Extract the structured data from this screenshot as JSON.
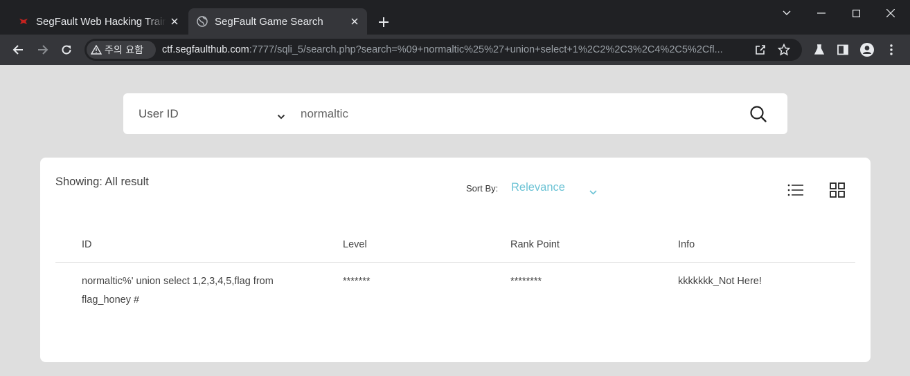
{
  "browser": {
    "tabs": [
      {
        "title": "SegFault Web Hacking Training",
        "icon": "segfault-favicon",
        "active": false
      },
      {
        "title": "SegFault Game Search",
        "icon": "globe-icon",
        "active": true
      }
    ],
    "security_chip": "주의 요함",
    "url_host": "ctf.segfaulthub.com",
    "url_rest": ":7777/sqli_5/search.php?search=%09+normaltic%25%27+union+select+1%2C2%2C3%2C4%2C5%2Cfl...",
    "colors": {
      "tabbar": "#202124",
      "toolbar": "#35363a",
      "text": "#e8eaed"
    }
  },
  "search": {
    "category": "User ID",
    "query": "normaltic"
  },
  "results": {
    "showing_label": "Showing: All result",
    "sort_label": "Sort By:",
    "sort_value": "Relevance",
    "columns": [
      "ID",
      "Level",
      "Rank Point",
      "Info"
    ],
    "rows": [
      {
        "id_line1": "normaltic%' union select 1,2,3,4,5,flag from",
        "id_line2": "flag_honey #",
        "level": "*******",
        "rank_point": "********",
        "info": "kkkkkkk_Not Here!"
      }
    ],
    "accent_color": "#6cc3d5"
  }
}
